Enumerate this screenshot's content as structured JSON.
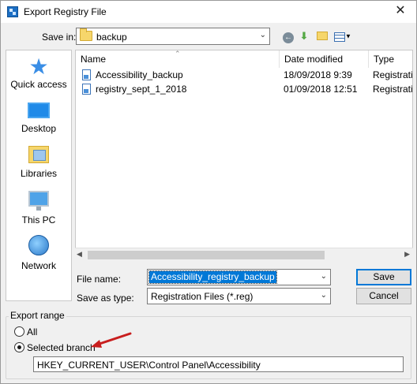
{
  "window": {
    "title": "Export Registry File",
    "close_glyph": "✕"
  },
  "save_in": {
    "label": "Save in:",
    "value": "backup"
  },
  "places": [
    {
      "label": "Quick access",
      "icon": "star-icon"
    },
    {
      "label": "Desktop",
      "icon": "desktop-icon"
    },
    {
      "label": "Libraries",
      "icon": "libraries-icon"
    },
    {
      "label": "This PC",
      "icon": "computer-icon"
    },
    {
      "label": "Network",
      "icon": "network-icon"
    }
  ],
  "columns": {
    "name": "Name",
    "date": "Date modified",
    "type": "Type"
  },
  "files": [
    {
      "name": "Accessibility_backup",
      "date": "18/09/2018 9:39",
      "type": "Registration"
    },
    {
      "name": "registry_sept_1_2018",
      "date": "01/09/2018 12:51",
      "type": "Registration"
    }
  ],
  "form": {
    "file_name_label": "File name:",
    "file_name_value": "Accessibility_registry_backup",
    "save_type_label": "Save as type:",
    "save_type_value": "Registration Files (*.reg)",
    "save_button": "Save",
    "cancel_button": "Cancel"
  },
  "export_range": {
    "title": "Export range",
    "all_label": "All",
    "selected_label": "Selected branch",
    "selected": "selected_branch",
    "branch_path": "HKEY_CURRENT_USER\\Control Panel\\Accessibility"
  },
  "colors": {
    "accent": "#0078d7",
    "annotation_arrow": "#c81e1e"
  }
}
